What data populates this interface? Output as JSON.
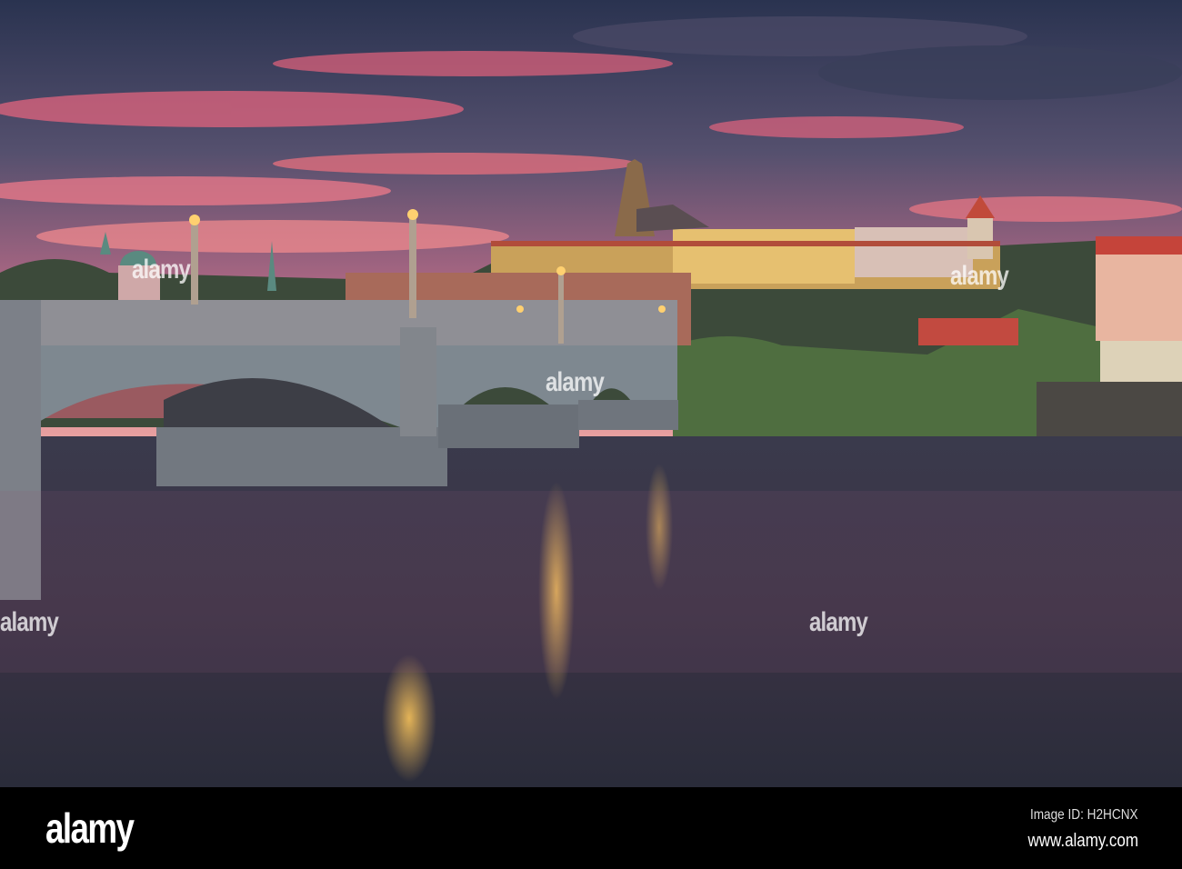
{
  "photo": {
    "watermark_text": "alamy",
    "colors": {
      "sky_top": "#2e3a55",
      "sky_pink": "#e0607a",
      "water": "#2b2d3d",
      "lights": "#f5b94a"
    }
  },
  "footer": {
    "logo": "alamy",
    "image_id": "Image ID: H2HCNX",
    "website": "www.alamy.com"
  }
}
